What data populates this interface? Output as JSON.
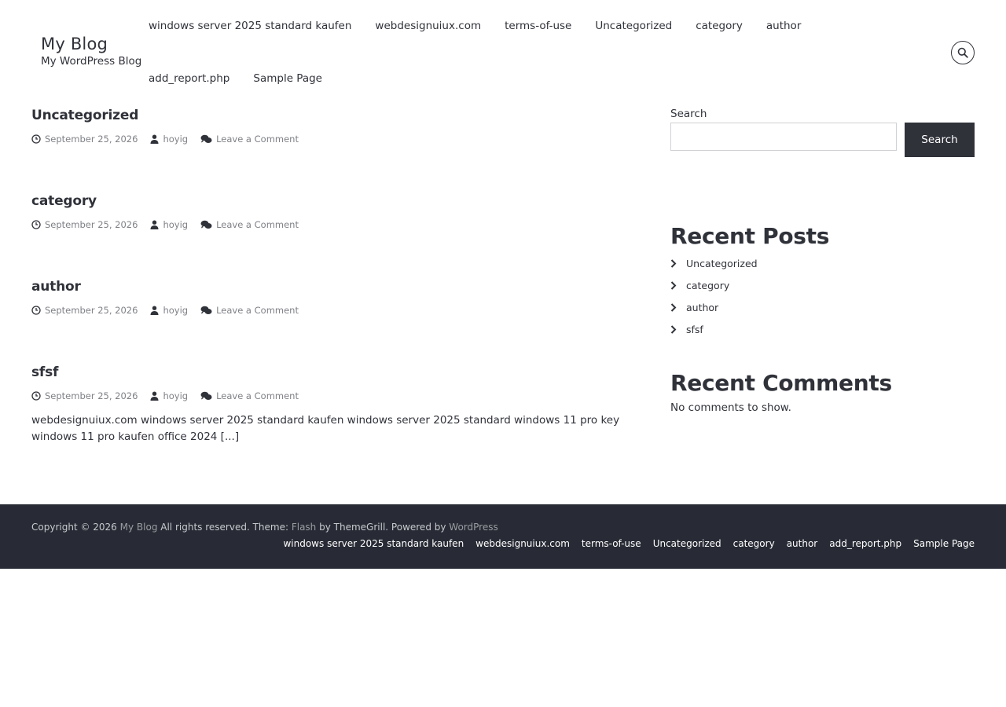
{
  "site": {
    "title": "My Blog",
    "description": "My WordPress Blog"
  },
  "nav": {
    "row1": [
      "windows server 2025 standard kaufen",
      "webdesignuiux.com",
      "terms-of-use",
      "Uncategorized",
      "category",
      "author"
    ],
    "row2": [
      "add_report.php",
      "Sample Page"
    ]
  },
  "header": {
    "search_icon": "search-icon"
  },
  "posts": [
    {
      "title": "Uncategorized",
      "date": "September 25, 2026",
      "author": "hoyig",
      "comments": "Leave a Comment",
      "excerpt": ""
    },
    {
      "title": "category",
      "date": "September 25, 2026",
      "author": "hoyig",
      "comments": "Leave a Comment",
      "excerpt": ""
    },
    {
      "title": "author",
      "date": "September 25, 2026",
      "author": "hoyig",
      "comments": "Leave a Comment",
      "excerpt": ""
    },
    {
      "title": "sfsf",
      "date": "September 25, 2026",
      "author": "hoyig",
      "comments": "Leave a Comment",
      "excerpt": "webdesignuiux.com windows server 2025 standard kaufen windows server 2025 standard windows 11 pro key windows 11 pro kaufen office 2024 [...]"
    }
  ],
  "sidebar": {
    "search_label": "Search",
    "search_placeholder": "",
    "search_button": "Search",
    "recent_posts_title": "Recent Posts",
    "recent_posts": [
      "Uncategorized",
      "category",
      "author",
      "sfsf"
    ],
    "recent_comments_title": "Recent Comments",
    "no_comments": "No comments to show."
  },
  "footer": {
    "copyright_prefix": "Copyright © 2026",
    "site_link": "My Blog",
    "rights": "All rights reserved. Theme:",
    "theme_link": "Flash",
    "by": "by ThemeGrill. Powered by",
    "wp_link": "WordPress",
    "nav": [
      "windows server 2025 standard kaufen",
      "webdesignuiux.com",
      "terms-of-use",
      "Uncategorized",
      "category",
      "author",
      "add_report.php",
      "Sample Page"
    ]
  },
  "colors": {
    "text": "#30323a",
    "meta": "#7f8187",
    "footer_bg": "#282b35",
    "button_bg": "#30323a"
  }
}
